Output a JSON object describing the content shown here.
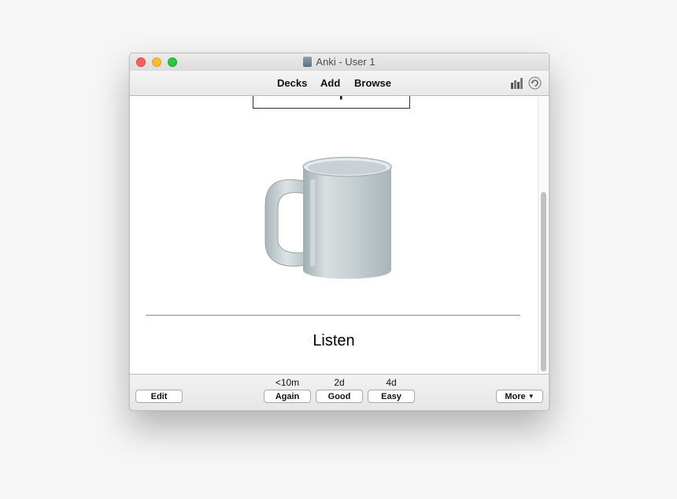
{
  "window": {
    "title": "Anki - User 1"
  },
  "toolbar": {
    "decks": "Decks",
    "add": "Add",
    "browse": "Browse"
  },
  "icons": {
    "stats": "stats-bars-icon",
    "sync": "sync-icon"
  },
  "card": {
    "front_word": "Cup",
    "back_text": "Listen"
  },
  "answer_buttons": [
    {
      "interval": "<10m",
      "label": "Again"
    },
    {
      "interval": "2d",
      "label": "Good"
    },
    {
      "interval": "4d",
      "label": "Easy"
    }
  ],
  "bottom": {
    "edit": "Edit",
    "more": "More"
  },
  "colors": {
    "close": "#fc5f57",
    "minimize": "#fdbc2e",
    "maximize": "#28c840"
  }
}
